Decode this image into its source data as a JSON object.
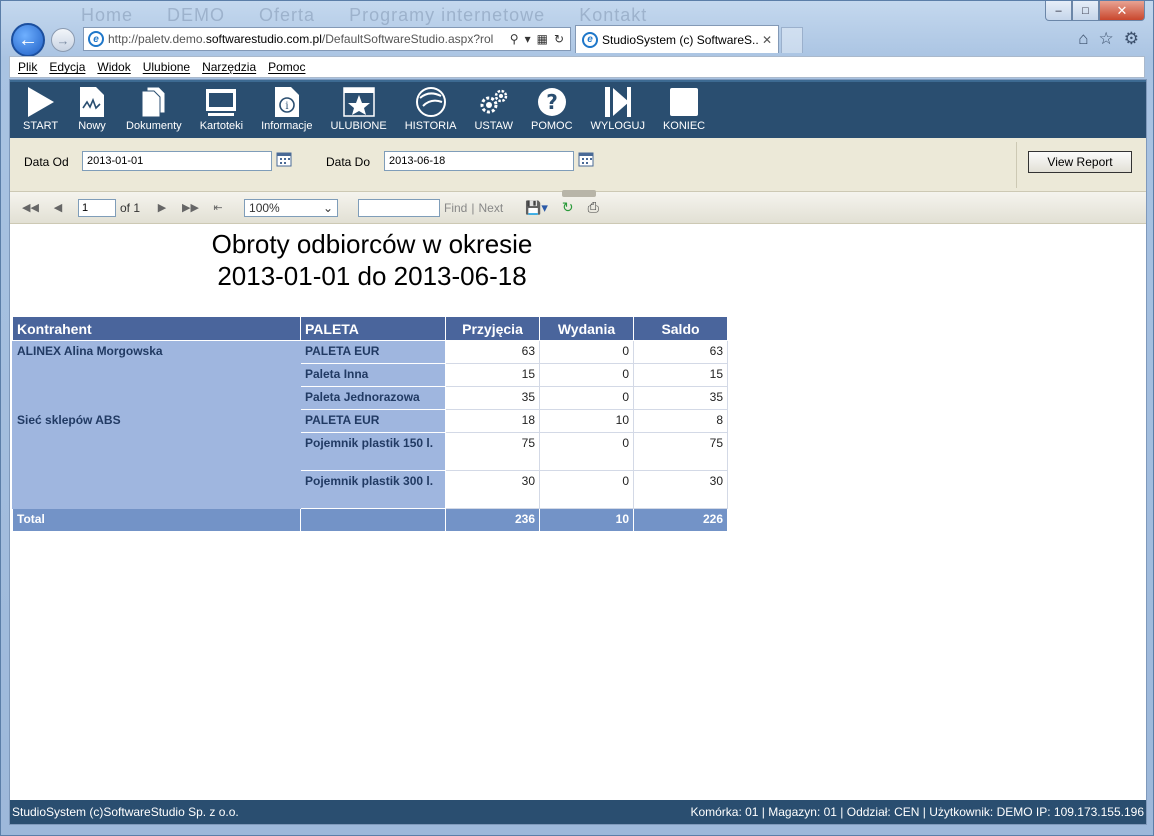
{
  "browser": {
    "ghost_menu": [
      "Home",
      "DEMO",
      "Oferta",
      "Programy internetowe",
      "Kontakt"
    ],
    "url_prefix": "http://paletv.demo.",
    "url_domain": "softwarestudio.com.pl",
    "url_suffix": "/DefaultSoftwareStudio.aspx?rol",
    "tab_title": "StudioSystem (c) SoftwareS...",
    "menu": [
      "Plik",
      "Edycja",
      "Widok",
      "Ulubione",
      "Narzędzia",
      "Pomoc"
    ]
  },
  "toolbar": {
    "buttons": [
      "START",
      "Nowy",
      "Dokumenty",
      "Kartoteki",
      "Informacje",
      "ULUBIONE",
      "HISTORIA",
      "USTAW",
      "POMOC",
      "WYLOGUJ",
      "KONIEC"
    ]
  },
  "params": {
    "date_from_label": "Data Od",
    "date_from_value": "2013-01-01",
    "date_to_label": "Data Do",
    "date_to_value": "2013-06-18",
    "view_report_label": "View Report"
  },
  "report_toolbar": {
    "page_value": "1",
    "page_of": "of 1",
    "zoom": "100%",
    "find_label": "Find",
    "separator": "|",
    "next_label": "Next"
  },
  "report": {
    "title_line1": "Obroty odbiorców w okresie",
    "title_line2": "2013-01-01 do 2013-06-18",
    "columns": [
      "Kontrahent",
      "PALETA",
      "Przyjęcia",
      "Wydania",
      "Saldo"
    ],
    "groups": [
      {
        "kontrahent": "ALINEX Alina Morgowska",
        "rows": [
          {
            "paleta": "PALETA EUR",
            "przyjecia": "63",
            "wydania": "0",
            "saldo": "63"
          },
          {
            "paleta": "Paleta Inna",
            "przyjecia": "15",
            "wydania": "0",
            "saldo": "15"
          },
          {
            "paleta": "Paleta Jednorazowa",
            "przyjecia": "35",
            "wydania": "0",
            "saldo": "35"
          }
        ]
      },
      {
        "kontrahent": "Sieć sklepów ABS",
        "rows": [
          {
            "paleta": "PALETA EUR",
            "przyjecia": "18",
            "wydania": "10",
            "saldo": "8"
          },
          {
            "paleta": "Pojemnik plastik 150 l.",
            "przyjecia": "75",
            "wydania": "0",
            "saldo": "75"
          },
          {
            "paleta": "Pojemnik plastik 300 l.",
            "przyjecia": "30",
            "wydania": "0",
            "saldo": "30"
          }
        ]
      }
    ],
    "total": {
      "label": "Total",
      "przyjecia": "236",
      "wydania": "10",
      "saldo": "226"
    }
  },
  "statusbar": {
    "left": "StudioSystem (c)SoftwareStudio Sp. z o.o.",
    "right": "Komórka: 01 | Magazyn: 01 | Oddział: CEN | Użytkownik: DEMO IP: 109.173.155.196"
  },
  "colors": {
    "toolbar_bg": "#2a4e70",
    "header_bg": "#4a659c",
    "group_bg": "#9fb6df",
    "total_bg": "#7393c7"
  }
}
